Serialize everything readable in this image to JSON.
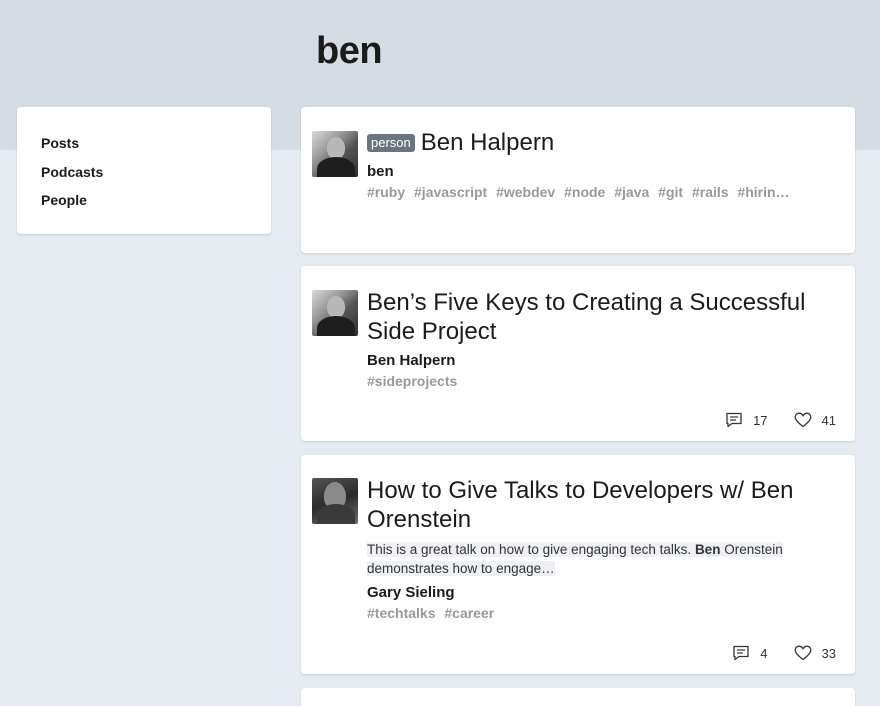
{
  "search": {
    "query": "ben"
  },
  "sidebar": {
    "items": [
      {
        "label": "Posts"
      },
      {
        "label": "Podcasts"
      },
      {
        "label": "People"
      }
    ]
  },
  "results": [
    {
      "kind": "person",
      "badge": "person",
      "name": "Ben Halpern",
      "username": "ben",
      "tags": [
        "#ruby",
        "#javascript",
        "#webdev",
        "#node",
        "#java",
        "#git",
        "#rails",
        "#hirin…"
      ]
    },
    {
      "kind": "post",
      "title": "Ben’s Five Keys to Creating a Successful Side Project",
      "author": "Ben Halpern",
      "tags": [
        "#sideprojects"
      ],
      "comments": "17",
      "reactions": "41"
    },
    {
      "kind": "post",
      "title": "How to Give Talks to Developers w/ Ben Orenstein",
      "snippet_pre": "This is a great talk on how to give engaging tech talks. ",
      "snippet_bold": "Ben",
      "snippet_post": " Orenstein demonstrates how to engage…",
      "author": "Gary Sieling",
      "tags": [
        "#techtalks",
        "#career"
      ],
      "comments": "4",
      "reactions": "33"
    }
  ],
  "icons": {
    "comment": "comment-icon",
    "heart": "heart-icon"
  }
}
